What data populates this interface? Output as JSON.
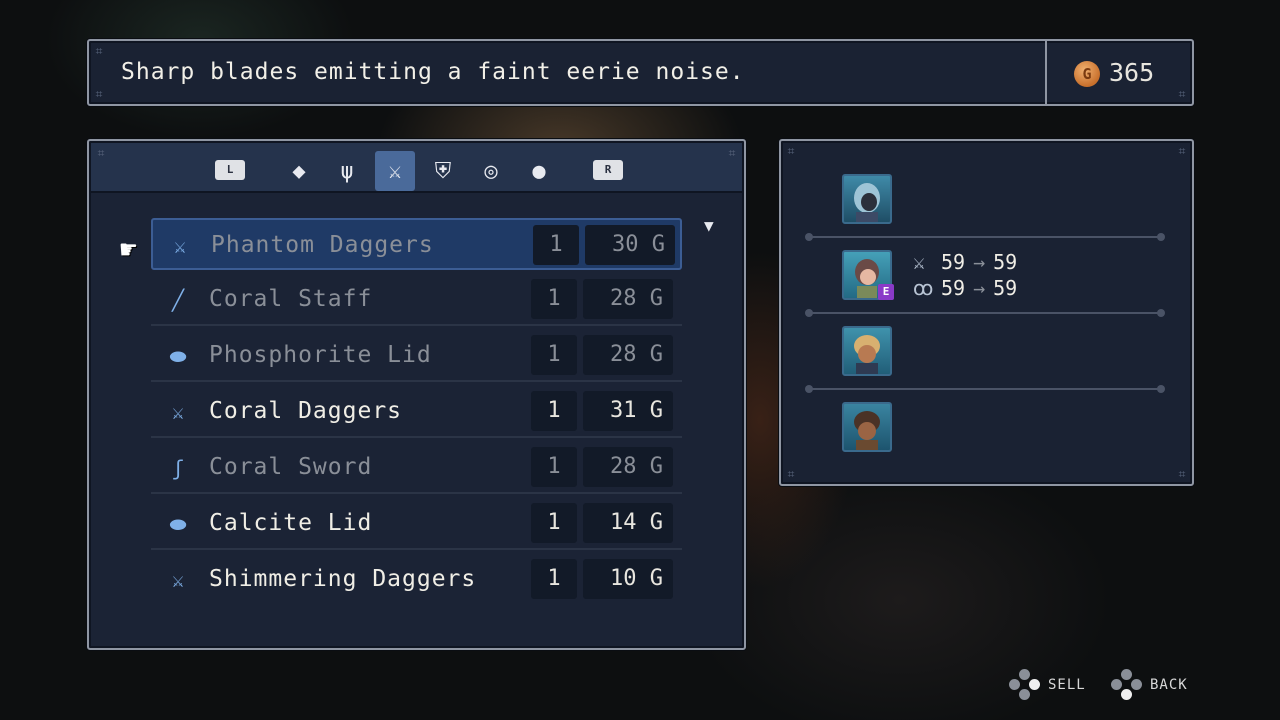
{
  "description": "Sharp blades emitting a faint eerie noise.",
  "gold": {
    "icon": "gold-coin-icon",
    "symbol": "G",
    "amount": "365"
  },
  "tabs": {
    "left_shoulder": "L",
    "right_shoulder": "R",
    "categories": [
      {
        "name": "gem",
        "glyph": "◆"
      },
      {
        "name": "fork",
        "glyph": "ψ"
      },
      {
        "name": "weapon",
        "glyph": "⚔",
        "active": true
      },
      {
        "name": "armor",
        "glyph": "⛨"
      },
      {
        "name": "ring",
        "glyph": "◎"
      },
      {
        "name": "consumable",
        "glyph": "●"
      }
    ]
  },
  "items": [
    {
      "icon": "daggers-icon",
      "glyph": "⚔",
      "name": "Phantom Daggers",
      "qty": "1",
      "price": "30 G",
      "selected": true,
      "dim": true
    },
    {
      "icon": "staff-icon",
      "glyph": "╱",
      "name": "Coral Staff",
      "qty": "1",
      "price": "28 G",
      "dim": true
    },
    {
      "icon": "lid-icon",
      "glyph": "⬬",
      "name": "Phosphorite Lid",
      "qty": "1",
      "price": "28 G",
      "dim": true
    },
    {
      "icon": "daggers-icon",
      "glyph": "⚔",
      "name": "Coral Daggers",
      "qty": "1",
      "price": "31 G",
      "dim": false
    },
    {
      "icon": "sword-icon",
      "glyph": "ʃ",
      "name": "Coral Sword",
      "qty": "1",
      "price": "28 G",
      "dim": true
    },
    {
      "icon": "lid-icon",
      "glyph": "⬬",
      "name": "Calcite Lid",
      "qty": "1",
      "price": "14 G",
      "dim": false
    },
    {
      "icon": "daggers-icon",
      "glyph": "⚔",
      "name": "Shimmering Daggers",
      "qty": "1",
      "price": "10 G",
      "dim": false
    }
  ],
  "party": {
    "equipped_badge": "E",
    "stats": [
      {
        "icon": "attack-icon",
        "glyph": "⚔",
        "from": "59",
        "arrow": "→",
        "to": "59"
      },
      {
        "icon": "magic-icon",
        "glyph": "ꝏ",
        "from": "59",
        "arrow": "→",
        "to": "59"
      }
    ],
    "member_colors": [
      "#2e6e8a",
      "#2a7894",
      "#2c6f88",
      "#285f7a"
    ]
  },
  "controls": {
    "sell": "SELL",
    "back": "BACK"
  }
}
